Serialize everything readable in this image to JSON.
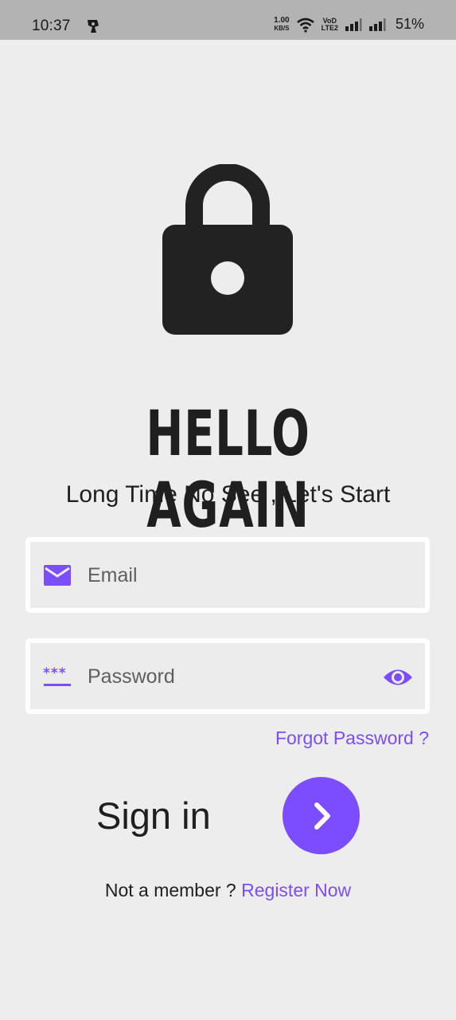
{
  "status_bar": {
    "time": "10:37",
    "net_speed_value": "1.00",
    "net_speed_unit": "KB/S",
    "volte_top": "VoD",
    "volte_bottom": "LTE2",
    "battery": "51%",
    "icons": [
      "app-notification-icon",
      "wifi-icon",
      "signal-icon-1",
      "signal-icon-2"
    ]
  },
  "hero": {
    "icon": "lock-icon",
    "headline": "HELLO AGAIN",
    "subtitle": "Long Time No See , Let's Start"
  },
  "form": {
    "email": {
      "placeholder": "Email",
      "value": "",
      "icon": "mail-icon"
    },
    "password": {
      "placeholder": "Password",
      "value": "",
      "icon": "password-icon",
      "toggle_icon": "eye-icon"
    },
    "forgot_password": "Forgot Password ?"
  },
  "actions": {
    "sign_in_label": "Sign in",
    "sign_in_button_icon": "chevron-right-icon",
    "register_prompt": "Not a member ?",
    "register_link": "Register Now"
  },
  "colors": {
    "accent": "#7c4dff",
    "background": "#ededed",
    "text": "#1f1f1f",
    "status_bar": "#b3b3b3"
  }
}
